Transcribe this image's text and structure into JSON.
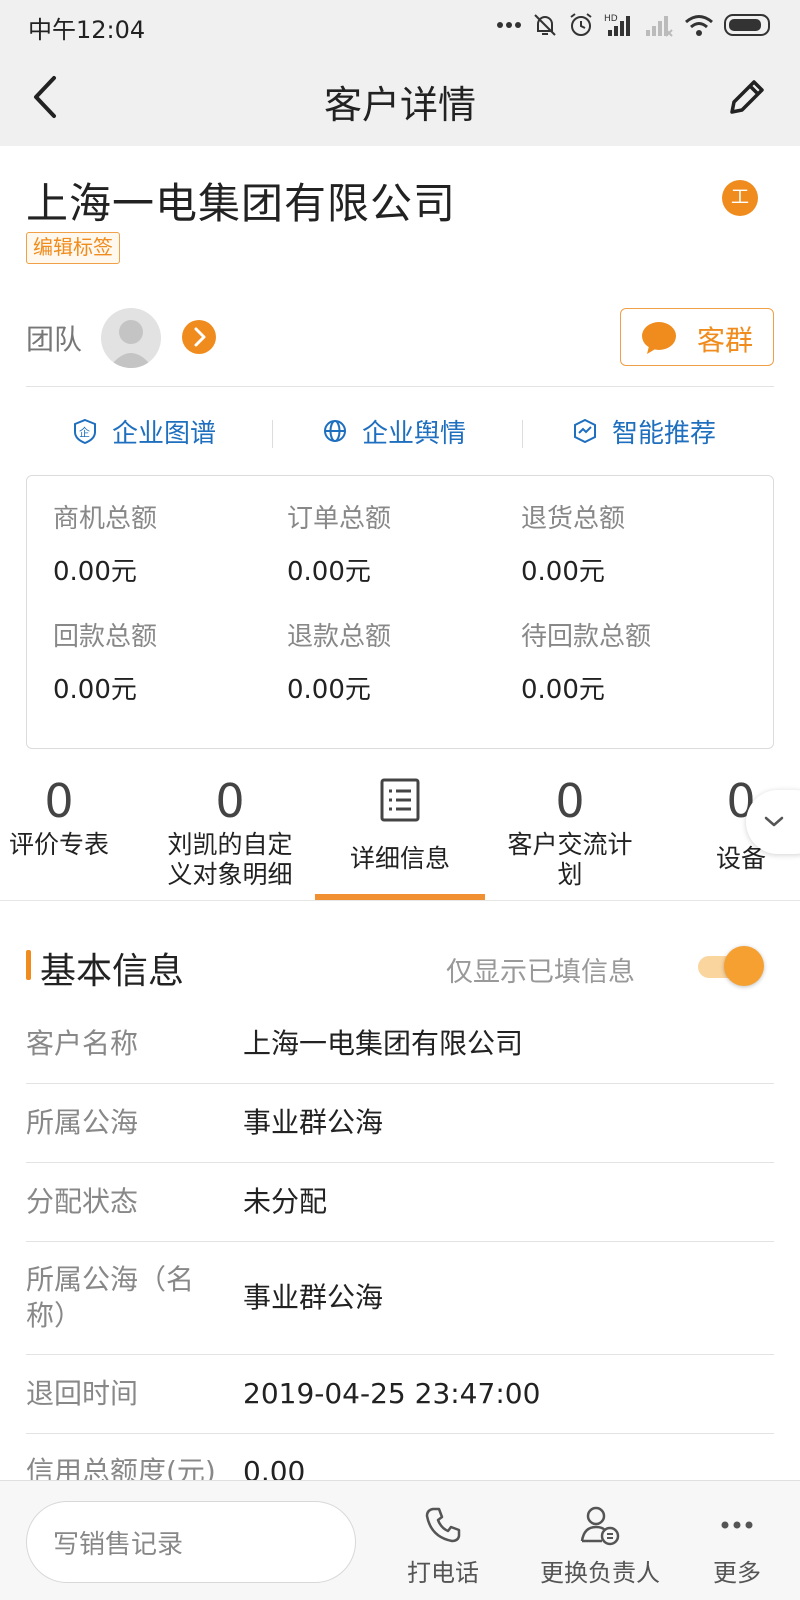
{
  "status_bar": {
    "time": "中午12:04",
    "icons": [
      "more-dots-icon",
      "bell-off-icon",
      "alarm-icon",
      "hd-signal-icon",
      "signal-weak-icon",
      "wifi-icon",
      "battery-icon"
    ]
  },
  "nav": {
    "title": "客户详情",
    "back_icon": "back-arrow-icon",
    "edit_icon": "edit-pencil-icon"
  },
  "header": {
    "company_name": "上海一电集团有限公司",
    "company_badge": "工",
    "tag_button": "编辑标签",
    "team_label": "团队",
    "group_button": "客群"
  },
  "quick_links": [
    {
      "label": "企业图谱",
      "icon": "enterprise-map-icon"
    },
    {
      "label": "企业舆情",
      "icon": "globe-icon"
    },
    {
      "label": "智能推荐",
      "icon": "smart-recommend-icon"
    }
  ],
  "stats": [
    {
      "label": "商机总额",
      "value": "0.00元"
    },
    {
      "label": "订单总额",
      "value": "0.00元"
    },
    {
      "label": "退货总额",
      "value": "0.00元"
    },
    {
      "label": "回款总额",
      "value": "0.00元"
    },
    {
      "label": "退款总额",
      "value": "0.00元"
    },
    {
      "label": "待回款总额",
      "value": "0.00元"
    }
  ],
  "tabs": [
    {
      "count": "0",
      "label": "评价专表"
    },
    {
      "count": "0",
      "label": "刘凯的自定义对象明细"
    },
    {
      "count": "",
      "label": "详细信息",
      "icon": "detail-list-icon",
      "active": true
    },
    {
      "count": "0",
      "label": "客户交流计划"
    },
    {
      "count": "0",
      "label": "设备"
    }
  ],
  "section": {
    "title": "基本信息",
    "filter_label": "仅显示已填信息",
    "filter_on": true
  },
  "fields": [
    {
      "label": "客户名称",
      "value": "上海一电集团有限公司"
    },
    {
      "label": "所属公海",
      "value": "事业群公海"
    },
    {
      "label": "分配状态",
      "value": "未分配"
    },
    {
      "label": "所属公海（名称）",
      "value": "事业群公海"
    },
    {
      "label": "退回时间",
      "value": "2019-04-25 23:47:00"
    },
    {
      "label": "信用总额度(元)",
      "value": "0.00"
    }
  ],
  "bottom_bar": {
    "input_placeholder": "写销售记录",
    "actions": [
      {
        "label": "打电话",
        "icon": "phone-icon"
      },
      {
        "label": "更换负责人",
        "icon": "change-owner-icon"
      },
      {
        "label": "更多",
        "icon": "more-icon"
      }
    ]
  },
  "colors": {
    "accent": "#f08c1e",
    "link": "#1f6fbf",
    "nav_bg": "#f0f0f0"
  }
}
